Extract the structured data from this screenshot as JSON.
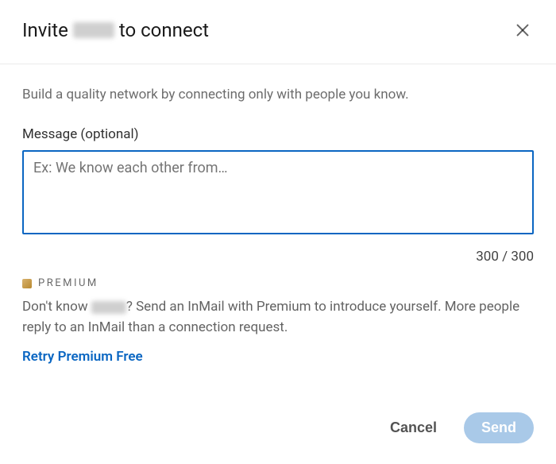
{
  "header": {
    "title_prefix": "Invite",
    "title_suffix": "to connect"
  },
  "body": {
    "subtitle": "Build a quality network by connecting only with people you know.",
    "message_label": "Message (optional)",
    "message_placeholder": "Ex: We know each other from…",
    "message_value": "",
    "char_counter": "300 / 300"
  },
  "premium": {
    "badge_label": "PREMIUM",
    "text_prefix": "Don't know ",
    "text_suffix": "? Send an InMail with Premium to introduce yourself. More people reply to an InMail than a connection request.",
    "retry_label": "Retry Premium Free"
  },
  "footer": {
    "cancel_label": "Cancel",
    "send_label": "Send"
  }
}
